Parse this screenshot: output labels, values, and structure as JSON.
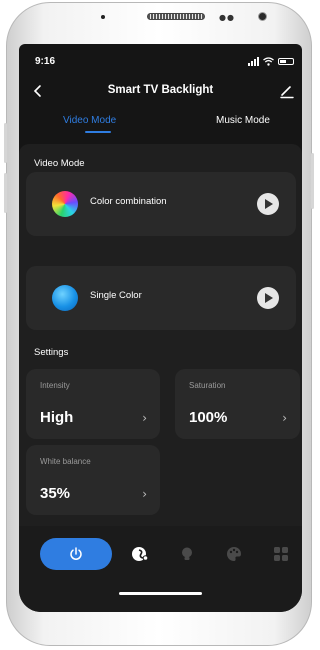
{
  "status_bar": {
    "time": "9:16"
  },
  "header": {
    "title": "Smart TV Backlight"
  },
  "tabs": [
    {
      "label": "Video Mode",
      "active": true
    },
    {
      "label": "Music Mode",
      "active": false
    }
  ],
  "video_section": {
    "label": "Video Mode",
    "modes": [
      {
        "label": "Color combination",
        "icon": "color-combination-icon"
      },
      {
        "label": "Single Color",
        "icon": "single-color-icon"
      }
    ]
  },
  "settings_section": {
    "label": "Settings",
    "cards": [
      {
        "label": "Intensity",
        "value": "High"
      },
      {
        "label": "Saturation",
        "value": "100%"
      },
      {
        "label": "White balance",
        "value": "35%"
      }
    ]
  },
  "bottom_nav": {
    "items": [
      "power-icon",
      "video-mode-icon",
      "light-bulb-icon",
      "palette-icon",
      "grid-icon"
    ]
  },
  "colors": {
    "accent": "#2f7de1",
    "background": "#151515",
    "panel": "#1f1f1f",
    "card": "#292929"
  }
}
